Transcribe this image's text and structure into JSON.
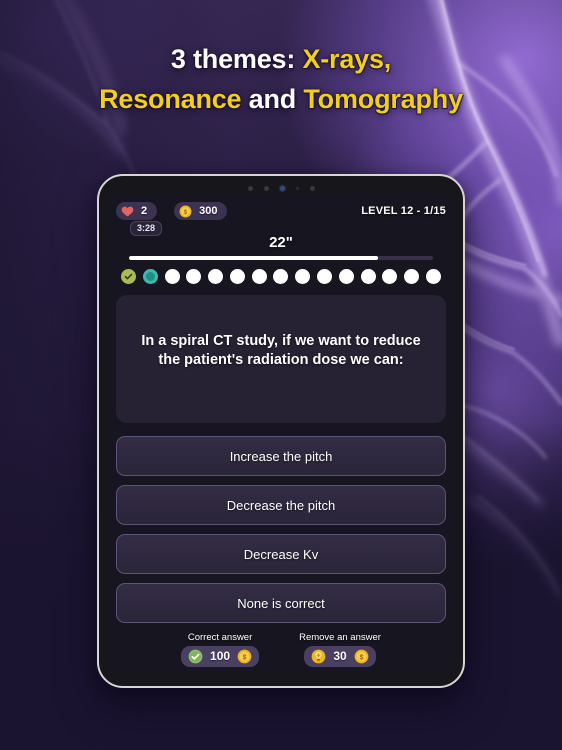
{
  "promo": {
    "headline_line1_a": "3 themes: ",
    "headline_line1_b": "X-rays,",
    "headline_line2_a": "Resonance",
    "headline_line2_b": " and ",
    "headline_line2_c": "Tomography",
    "accent_color": "#f2cf1c",
    "text_color": "#ffffff"
  },
  "hud": {
    "lives": "2",
    "lives_timer": "3:28",
    "coins": "300",
    "level_label": "LEVEL 12 - 1/15",
    "heart_icon": "heart-icon",
    "coin_icon": "coin-icon"
  },
  "timer": {
    "countdown": "22\"",
    "progress_percent": 82
  },
  "progress_dots": [
    {
      "state": "done"
    },
    {
      "state": "current"
    },
    {
      "state": "pending"
    },
    {
      "state": "pending"
    },
    {
      "state": "pending"
    },
    {
      "state": "pending"
    },
    {
      "state": "pending"
    },
    {
      "state": "pending"
    },
    {
      "state": "pending"
    },
    {
      "state": "pending"
    },
    {
      "state": "pending"
    },
    {
      "state": "pending"
    },
    {
      "state": "pending"
    },
    {
      "state": "pending"
    },
    {
      "state": "pending"
    }
  ],
  "question": {
    "text": "In a spiral CT study, if we want to reduce the patient's radiation dose we can:"
  },
  "answers": [
    {
      "label": "Increase the pitch"
    },
    {
      "label": "Decrease the pitch"
    },
    {
      "label": "Decrease Kv"
    },
    {
      "label": "None is correct"
    }
  ],
  "powerups": [
    {
      "label": "Correct answer",
      "cost": "100",
      "icon": "check-circle-icon",
      "currency_icon": "coin-icon"
    },
    {
      "label": "Remove an answer",
      "cost": "30",
      "icon": "lightbulb-icon",
      "currency_icon": "coin-icon"
    }
  ]
}
